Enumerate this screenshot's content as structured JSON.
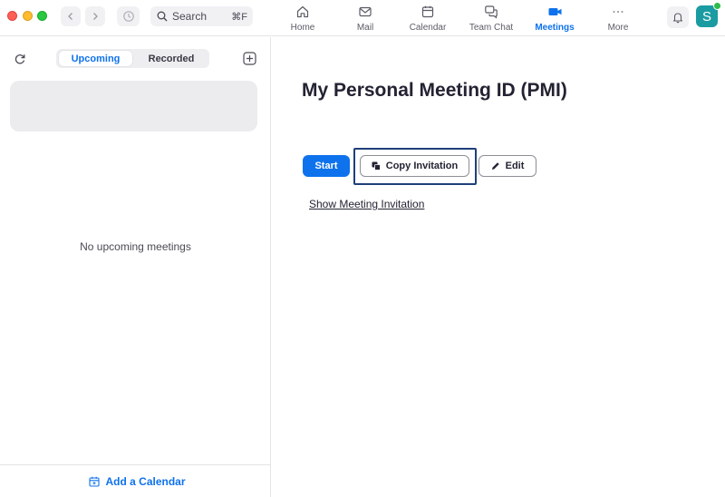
{
  "search": {
    "label": "Search",
    "shortcut": "⌘F"
  },
  "nav_tabs": [
    {
      "label": "Home",
      "icon": "home-icon",
      "active": false
    },
    {
      "label": "Mail",
      "icon": "mail-icon",
      "active": false
    },
    {
      "label": "Calendar",
      "icon": "calendar-icon",
      "active": false
    },
    {
      "label": "Team Chat",
      "icon": "chat-icon",
      "active": false
    },
    {
      "label": "Meetings",
      "icon": "video-camera-icon",
      "active": true
    },
    {
      "label": "More",
      "icon": "more-dots-icon",
      "active": false
    }
  ],
  "user": {
    "avatar_initial": "S",
    "status": "online"
  },
  "left_panel": {
    "tabs": {
      "upcoming": "Upcoming",
      "recorded": "Recorded",
      "selected": "upcoming"
    },
    "empty_message": "No upcoming meetings",
    "footer_link": "Add a Calendar"
  },
  "main": {
    "title": "My Personal Meeting ID (PMI)",
    "start_label": "Start",
    "copy_label": "Copy Invitation",
    "edit_label": "Edit",
    "show_invitation_label": "Show Meeting Invitation"
  },
  "colors": {
    "accent": "#0e72ed",
    "avatar_bg": "#1a9ba1",
    "status_online": "#2dbb4c",
    "focus_ring": "#1f3f7a"
  }
}
